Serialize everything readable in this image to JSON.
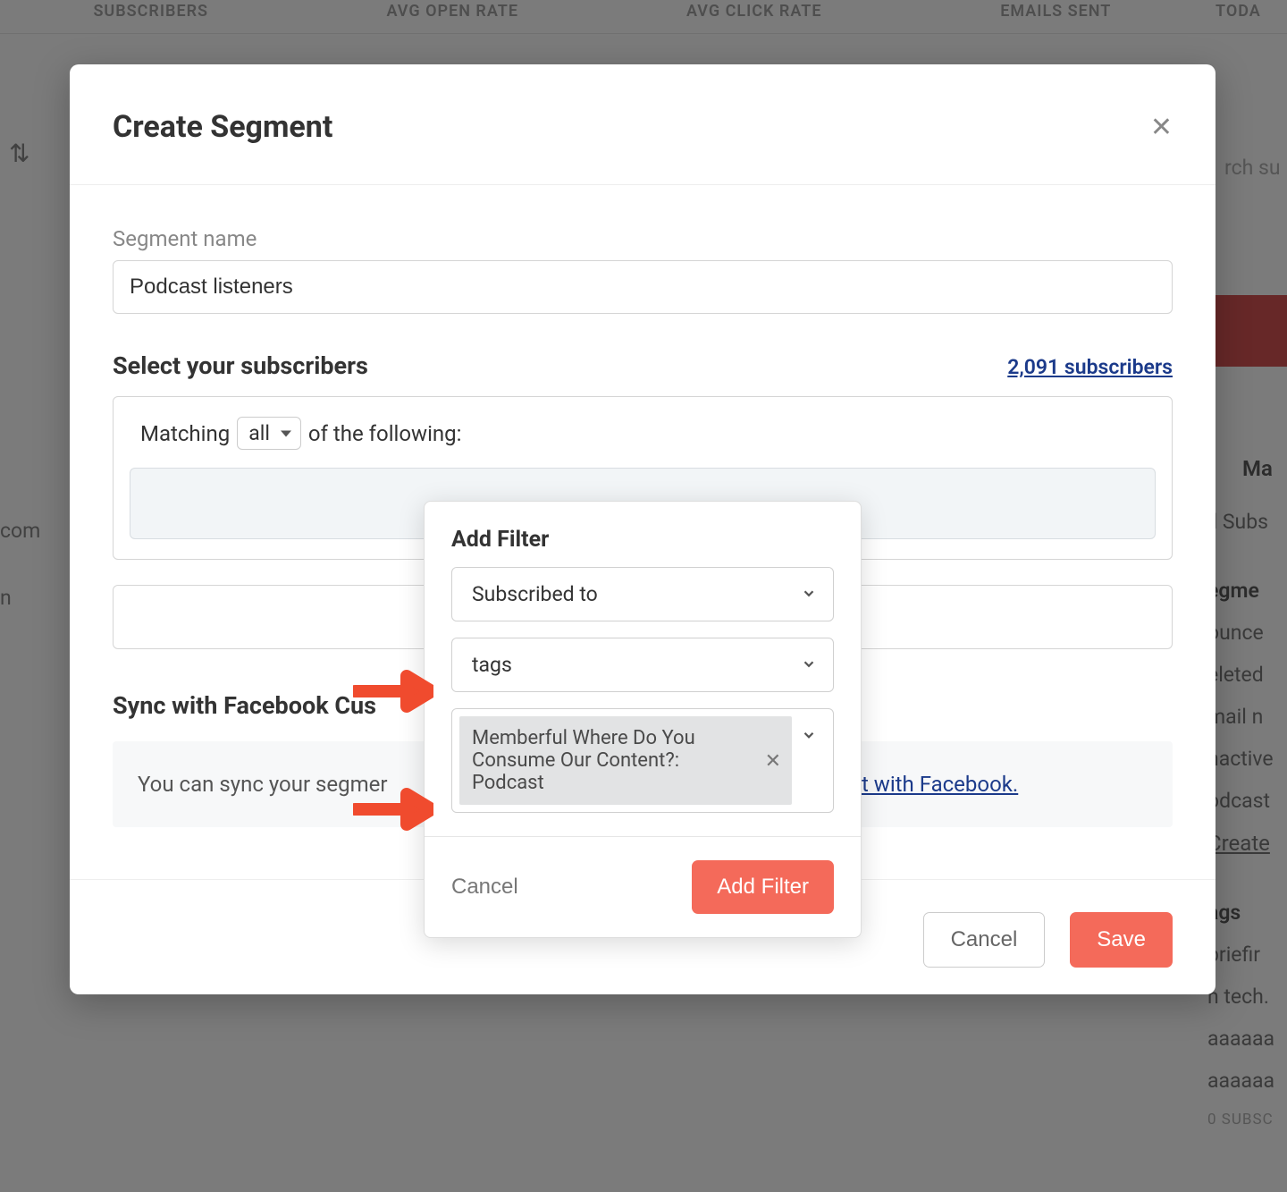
{
  "bg": {
    "stats": [
      "SUBSCRIBERS",
      "AVG OPEN RATE",
      "AVG CLICK RATE",
      "EMAILS SENT",
      "TODA"
    ],
    "search_placeholder": "rch su",
    "sort_symbol": "⇅",
    "row1": "com",
    "row2": "n",
    "sidebar": {
      "ma": "Ma",
      "allsub": "ll Subs",
      "header_segments": "egme",
      "items": [
        "ounce",
        "eleted",
        "mail n",
        "nactive",
        "odcast"
      ],
      "create": "Create",
      "tags_header": "ags",
      "tag1": "briefir",
      "tag2": "n tech.",
      "tag3": "aaaaaa",
      "tag4": "aaaaaa",
      "subcount": "0 SUBSC"
    }
  },
  "modal": {
    "title": "Create Segment",
    "segment_name_label": "Segment name",
    "segment_name_value": "Podcast listeners",
    "select_title": "Select your subscribers",
    "subscriber_count": "2,091 subscribers",
    "matching_pre": "Matching",
    "matching_mode": "all",
    "matching_post": "of the following:",
    "sync_title": "Sync with Facebook Cus",
    "sync_text_pre": "You can sync your segmer",
    "sync_link": "nect with Facebook.",
    "cancel": "Cancel",
    "save": "Save"
  },
  "popover": {
    "title": "Add Filter",
    "field1": "Subscribed to",
    "field2": "tags",
    "selected_tag": "Memberful Where Do You Consume Our Content?: Podcast",
    "cancel": "Cancel",
    "add": "Add Filter"
  }
}
